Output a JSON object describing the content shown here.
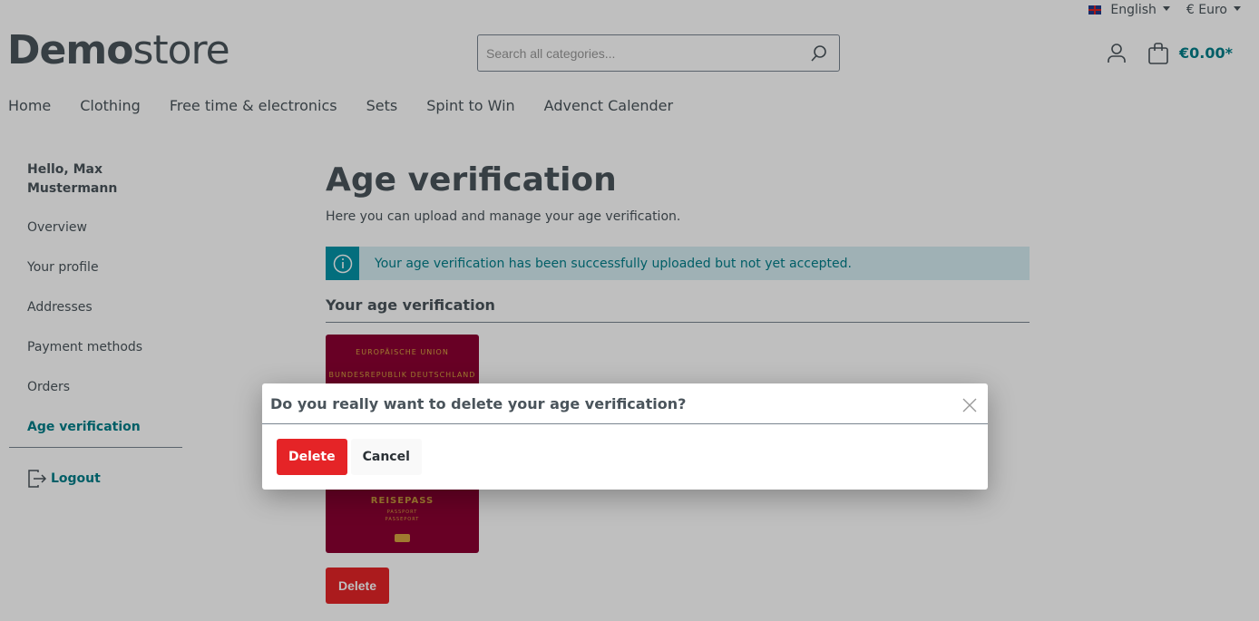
{
  "topbar": {
    "language": "English",
    "currency": "€ Euro",
    "flag_icon": "uk-flag-icon"
  },
  "header": {
    "logo_bold": "Demo",
    "logo_light": "store",
    "search_placeholder": "Search all categories...",
    "cart_total": "€0.00*"
  },
  "nav": [
    "Home",
    "Clothing",
    "Free time & electronics",
    "Sets",
    "Spint to Win",
    "Advenct Calender"
  ],
  "sidebar": {
    "greeting": "Hello, Max Mustermann",
    "items": [
      "Overview",
      "Your profile",
      "Addresses",
      "Payment methods",
      "Orders",
      "Age verification"
    ],
    "active": "Age verification",
    "logout": "Logout"
  },
  "main": {
    "title": "Age verification",
    "subtitle": "Here you can upload and manage your age verification.",
    "alert": "Your age verification has been successfully uploaded but not yet accepted.",
    "section_title": "Your age verification",
    "delete_label": "Delete",
    "passport": {
      "union": "EUROPÄISCHE UNION",
      "country": "BUNDESREPUBLIK DEUTSCHLAND",
      "title": "REISEPASS",
      "sub1": "PASSPORT",
      "sub2": "PASSEPORT"
    }
  },
  "modal": {
    "title": "Do you really want to delete your age verification?",
    "delete": "Delete",
    "cancel": "Cancel"
  },
  "colors": {
    "accent": "#007e89",
    "danger": "#e52427",
    "info": "#0593a7"
  }
}
